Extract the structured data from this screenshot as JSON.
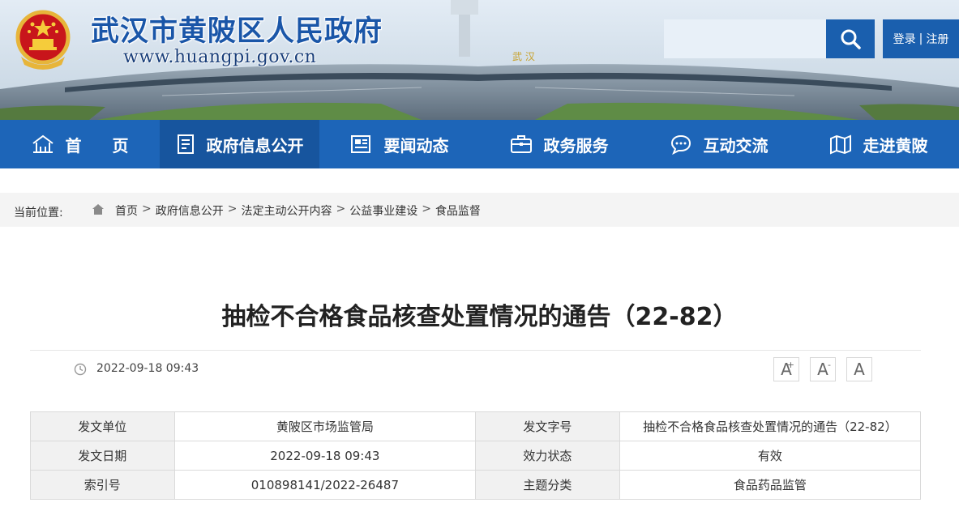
{
  "header": {
    "site_title": "武汉市黄陂区人民政府",
    "site_url": "www.huangpi.gov.cn",
    "search_placeholder": "",
    "login": "登录",
    "separator": "|",
    "register": "注册",
    "banner_sign": "武 汉"
  },
  "nav": {
    "items": [
      {
        "label": "首页",
        "icon": "home-icon"
      },
      {
        "label": "政府信息公开",
        "icon": "document-icon"
      },
      {
        "label": "要闻动态",
        "icon": "news-icon"
      },
      {
        "label": "政务服务",
        "icon": "briefcase-icon"
      },
      {
        "label": "互动交流",
        "icon": "chat-icon"
      },
      {
        "label": "走进黄陂",
        "icon": "map-icon"
      }
    ],
    "active_index": 1
  },
  "breadcrumb": {
    "prefix": "当前位置:",
    "items": [
      "首页",
      "政府信息公开",
      "法定主动公开内容",
      "公益事业建设",
      "食品监督"
    ],
    "separator": ">"
  },
  "article": {
    "title": "抽检不合格食品核查处置情况的通告（22-82）",
    "date": "2022-09-18 09:43",
    "font_buttons": [
      "A",
      "A",
      "A"
    ],
    "font_button_marks": [
      "+",
      "-",
      ""
    ]
  },
  "info_table": {
    "rows": [
      {
        "k1": "发文单位",
        "v1": "黄陂区市场监管局",
        "k2": "发文字号",
        "v2": "抽检不合格食品核查处置情况的通告（22-82）"
      },
      {
        "k1": "发文日期",
        "v1": "2022-09-18 09:43",
        "k2": "效力状态",
        "v2": "有效"
      },
      {
        "k1": "索引号",
        "v1": "010898141/2022-26487",
        "k2": "主题分类",
        "v2": "食品药品监管"
      }
    ]
  },
  "colors": {
    "nav_blue": "#1d65b8",
    "nav_active": "#17559e",
    "header_blue": "#1a5fae",
    "title_blue": "#1a56a8"
  }
}
